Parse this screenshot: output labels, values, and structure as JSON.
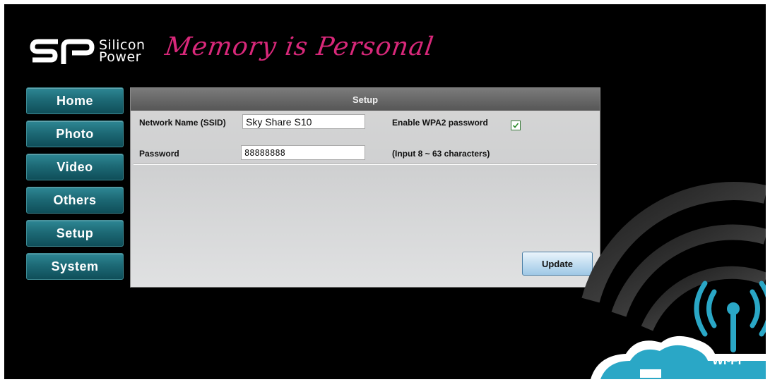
{
  "brand": {
    "name_line1": "Silicon",
    "name_line2": "Power",
    "tagline": "Memory is Personal"
  },
  "sidebar": {
    "items": [
      {
        "label": "Home"
      },
      {
        "label": "Photo"
      },
      {
        "label": "Video"
      },
      {
        "label": "Others"
      },
      {
        "label": "Setup"
      },
      {
        "label": "System"
      }
    ]
  },
  "panel": {
    "title": "Setup",
    "ssid_label": "Network Name (SSID)",
    "ssid_value": "Sky Share S10",
    "wpa2_label": "Enable WPA2 password",
    "wpa2_checked": true,
    "password_label": "Password",
    "password_value": "88888888",
    "password_hint": "(Input 8 ~ 63 characters)",
    "update_label": "Update"
  },
  "wifi_badge": {
    "label": "Wi-Fi"
  },
  "colors": {
    "nav": "#1d6a76",
    "tagline": "#d8287a",
    "wifi": "#2aa7c6"
  }
}
